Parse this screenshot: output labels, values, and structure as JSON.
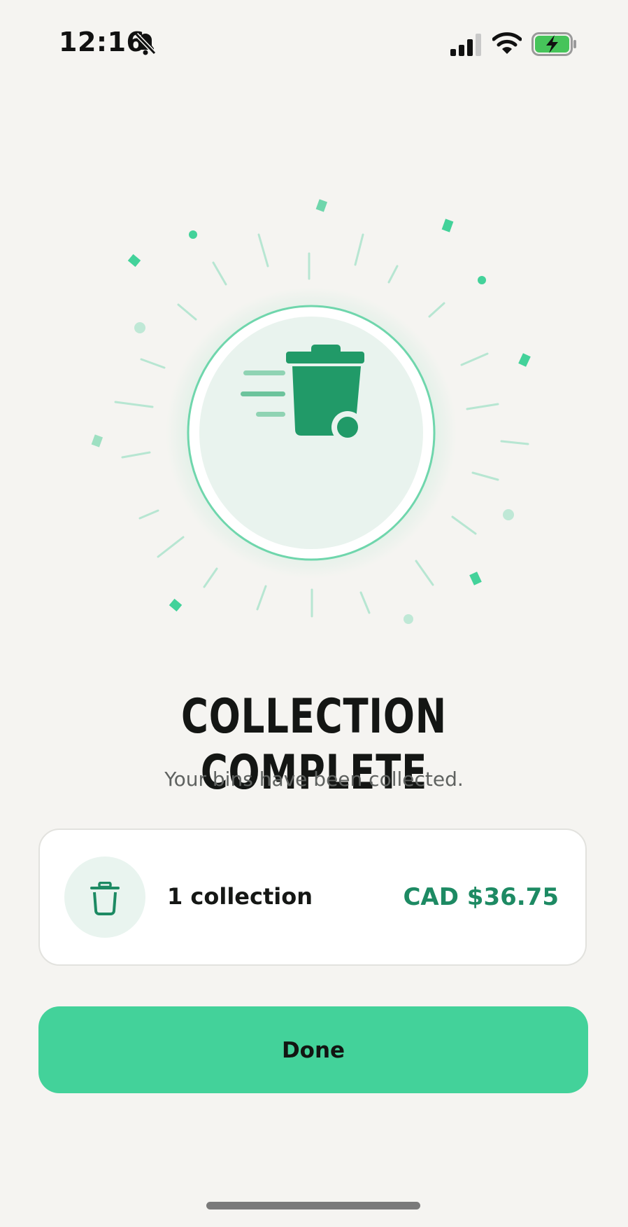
{
  "status_bar": {
    "time": "12:16",
    "icons": [
      "bell-off-icon",
      "signal-icon",
      "wifi-icon",
      "battery-charging-icon"
    ]
  },
  "hero": {
    "icon": "trash-bin-moving-icon"
  },
  "title": "COLLECTION COMPLETE",
  "subtitle": "Your bins have been collected.",
  "summary": {
    "icon": "trash-icon",
    "count_label": "1 collection",
    "price": "CAD $36.75"
  },
  "done_button": {
    "label": "Done"
  },
  "colors": {
    "accent": "#43d29a",
    "accent_dark": "#1d8a63",
    "background": "#f5f4f1"
  }
}
